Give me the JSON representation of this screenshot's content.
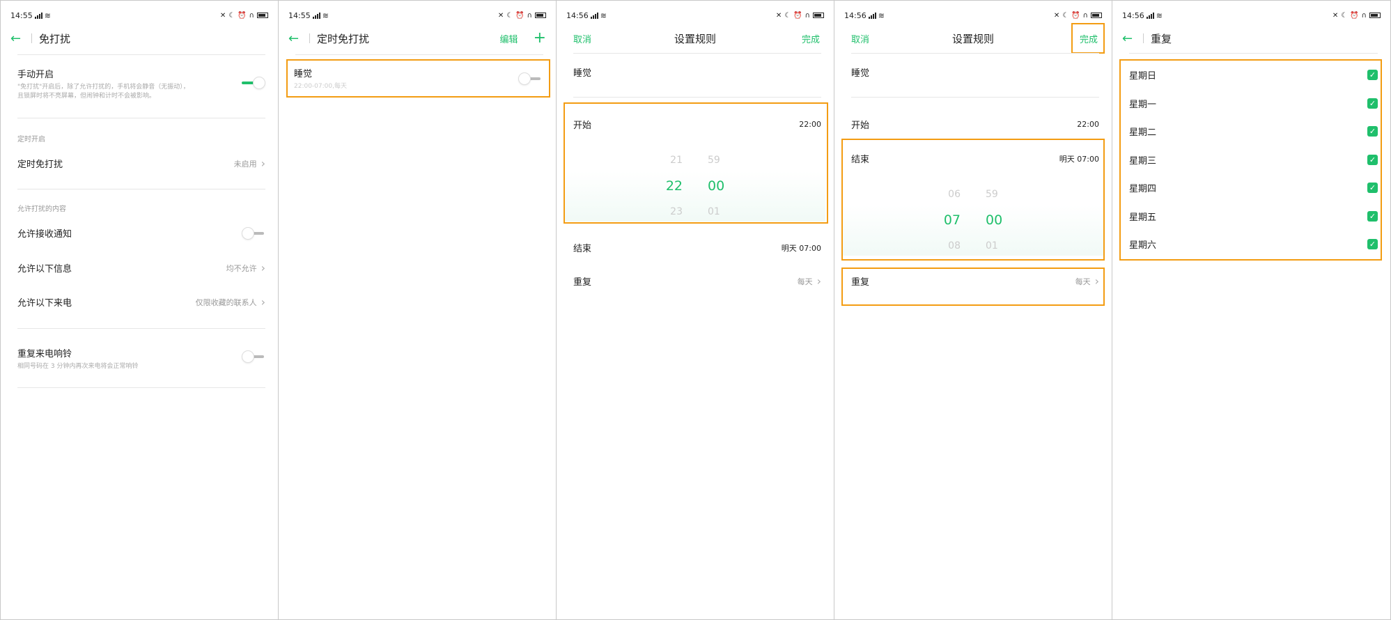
{
  "accent": "#1fbf6b",
  "highlight": "#f39c12",
  "panels": [
    {
      "status": {
        "time": "14:55"
      },
      "header": {
        "back_icon": "back-arrow-icon",
        "title": "免打扰"
      },
      "manual": {
        "label": "手动开启",
        "desc1": "\"免打扰\"开启后，除了允许打扰的，手机将会静音（无振动），",
        "desc2": "且锁屏时将不亮屏幕，但闹钟和计时不会被影响。",
        "on": true
      },
      "schedule_section": "定时开启",
      "schedule": {
        "label": "定时免打扰",
        "value": "未启用"
      },
      "allow_section": "允许打扰的内容",
      "allow_notify": {
        "label": "允许接收通知",
        "on": false
      },
      "allow_msg": {
        "label": "允许以下信息",
        "value": "均不允许"
      },
      "allow_call": {
        "label": "允许以下来电",
        "value": "仅限收藏的联系人"
      },
      "repeat_call": {
        "label": "重复来电响铃",
        "desc": "相同号码在 3 分钟内再次来电将会正常响铃",
        "on": false
      }
    },
    {
      "status": {
        "time": "14:55"
      },
      "header": {
        "title": "定时免打扰",
        "edit": "编辑",
        "add_icon": "plus-icon"
      },
      "rule": {
        "name": "睡觉",
        "desc": "22:00-07:00,每天",
        "on": false
      }
    },
    {
      "status": {
        "time": "14:56"
      },
      "header": {
        "cancel": "取消",
        "title": "设置规则",
        "done": "完成"
      },
      "name": "睡觉",
      "start": {
        "label": "开始",
        "value": "22:00"
      },
      "picker": {
        "prev_h": "21",
        "prev_m": "59",
        "sel_h": "22",
        "sel_m": "00",
        "next_h": "23",
        "next_m": "01"
      },
      "end": {
        "label": "结束",
        "value": "明天 07:00"
      },
      "repeat": {
        "label": "重复",
        "value": "每天"
      }
    },
    {
      "status": {
        "time": "14:56"
      },
      "header": {
        "cancel": "取消",
        "title": "设置规则",
        "done": "完成"
      },
      "name": "睡觉",
      "start": {
        "label": "开始",
        "value": "22:00"
      },
      "end": {
        "label": "结束",
        "value": "明天 07:00"
      },
      "picker": {
        "prev_h": "06",
        "prev_m": "59",
        "sel_h": "07",
        "sel_m": "00",
        "next_h": "08",
        "next_m": "01"
      },
      "repeat": {
        "label": "重复",
        "value": "每天"
      }
    },
    {
      "status": {
        "time": "14:56"
      },
      "header": {
        "title": "重复"
      },
      "days": [
        {
          "label": "星期日",
          "checked": true
        },
        {
          "label": "星期一",
          "checked": true
        },
        {
          "label": "星期二",
          "checked": true
        },
        {
          "label": "星期三",
          "checked": true
        },
        {
          "label": "星期四",
          "checked": true
        },
        {
          "label": "星期五",
          "checked": true
        },
        {
          "label": "星期六",
          "checked": true
        }
      ]
    }
  ]
}
